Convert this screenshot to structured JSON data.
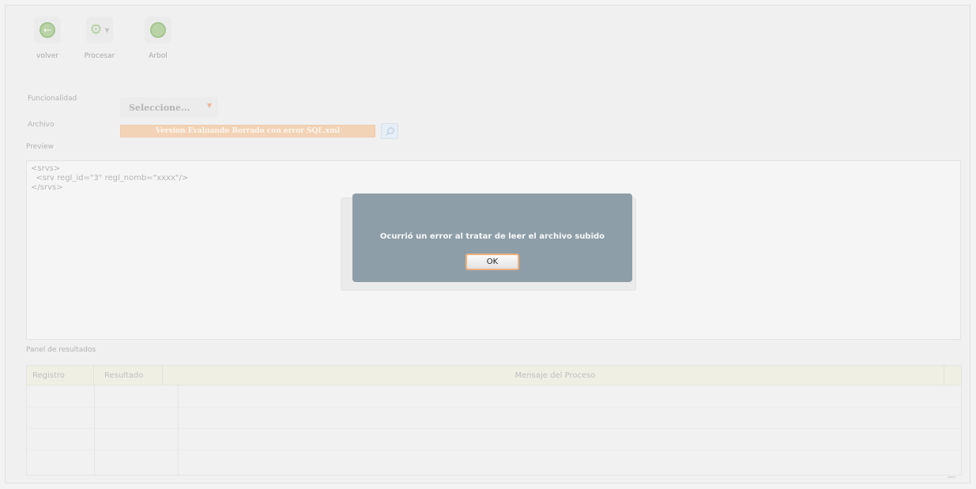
{
  "toolbar": {
    "back_label": "volver",
    "process_label": "Procesar",
    "tree_label": "Arbol"
  },
  "form": {
    "functionality_label": "Funcionalidad",
    "functionality_value": "Seleccione...",
    "file_label": "Archivo",
    "file_name": "Version Evaluando Borrado con error SQL.xml",
    "preview_label": "Preview"
  },
  "preview": {
    "lines": [
      "<srvs>",
      "  <srv regl_id=\"3\" regl_nomb=\"xxxx\"/>",
      "</srvs>"
    ]
  },
  "results": {
    "panel_label": "Panel de resultados",
    "columns": [
      "Registro",
      "Resultado",
      "Mensaje del Proceso"
    ]
  },
  "dialog": {
    "message": "Ocurrió un error al tratar de leer el archivo subido",
    "ok_label": "OK"
  },
  "colors": {
    "dialog_bg": "#8e9ea8",
    "ok_border": "#f0b17d",
    "file_field": "#f2d3b6"
  }
}
